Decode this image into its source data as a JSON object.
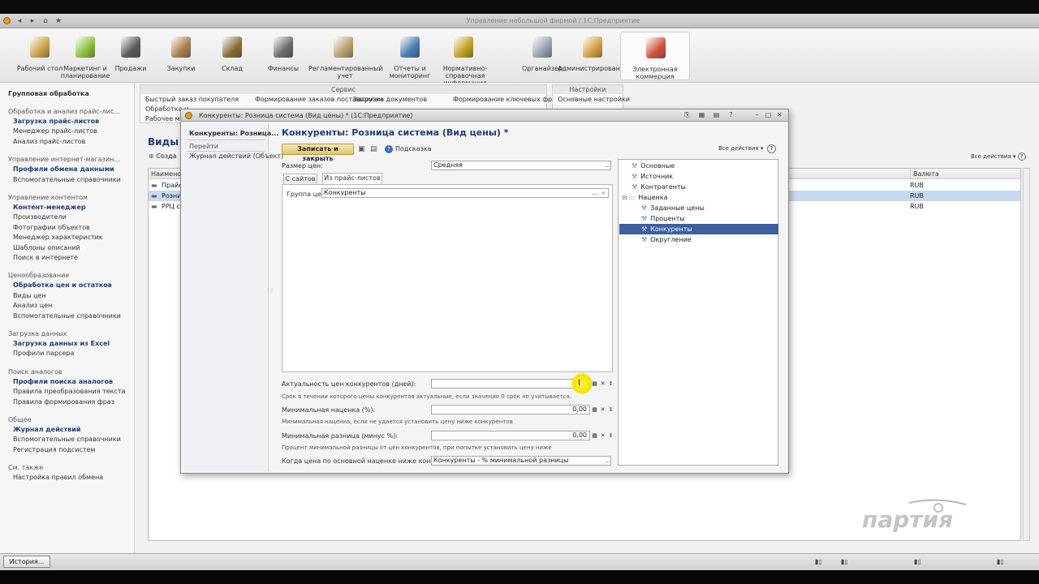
{
  "titlebar": {
    "title": "Управление небольшой фирмой / 1С:Предприятие"
  },
  "sections": [
    {
      "label": "Рабочий стол",
      "icon": "desk-icon",
      "color": "#c8a24a"
    },
    {
      "label": "Маркетинг и планирование",
      "icon": "marketing-icon",
      "color": "#8bbf3a"
    },
    {
      "label": "Продажи",
      "icon": "sales-icon",
      "color": "#5a5a5a"
    },
    {
      "label": "Закупки",
      "icon": "purchases-icon",
      "color": "#a88050"
    },
    {
      "label": "Склад",
      "icon": "warehouse-icon",
      "color": "#8a6a3a"
    },
    {
      "label": "Финансы",
      "icon": "finance-icon",
      "color": "#6a6a6a"
    },
    {
      "label": "Регламентированный учет",
      "icon": "accounting-icon",
      "color": "#b8a070"
    },
    {
      "label": "Отчеты и мониторинг",
      "icon": "reports-icon",
      "color": "#4a7ab0"
    },
    {
      "label": "Нормативно-справочная информация",
      "icon": "reference-icon",
      "color": "#c0a020"
    },
    {
      "label": "Органайзер",
      "icon": "organizer-icon",
      "color": "#9aa0a8"
    },
    {
      "label": "Администрирование",
      "icon": "admin-icon",
      "color": "#d0a040"
    },
    {
      "label": "Электронная коммерция",
      "icon": "ecommerce-icon",
      "color": "#d05040"
    }
  ],
  "service": {
    "caption": "Сервис",
    "items": [
      "Быстрый заказ покупателя",
      "Формирование заказов поставщикам",
      "Загрузка документов",
      "Формирование ключевых фраз",
      "Обработка н",
      "Рабочее мес"
    ],
    "settings_caption": "Настройки",
    "settings_item": "Основные настройки"
  },
  "left": {
    "top": "Групповая обработка",
    "groups": [
      {
        "title": "Обработка и анализ прайс-лис...",
        "items": [
          "Загрузка прайс-листов",
          "Менеджер прайс-листов",
          "Анализ прайс-листов"
        ],
        "bold": [
          0
        ]
      },
      {
        "title": "Управление интернет-магазин...",
        "items": [
          "Профили обмена данными",
          "Вспомогательные справочники"
        ],
        "bold": [
          0
        ]
      },
      {
        "title": "Управление контентом",
        "items": [
          "Контент-менеджер",
          "Производители",
          "Фотографии объектов",
          "Менеджер характеристик",
          "Шаблоны описаний",
          "Поиск в интернете"
        ],
        "bold": [
          0
        ]
      },
      {
        "title": "Ценообразование",
        "items": [
          "Обработка цен и остатков",
          "Виды цен",
          "Анализ цен",
          "Вспомогательные справочники"
        ],
        "bold": [
          0
        ]
      },
      {
        "title": "Загрузка данных",
        "items": [
          "Загрузка данных из Excel",
          "Профили парсера"
        ],
        "bold": [
          0
        ]
      },
      {
        "title": "Поиск аналогов",
        "items": [
          "Профили поиска аналогов",
          "Правила преобразования текста",
          "Правила формирования фраз"
        ],
        "bold": [
          0
        ]
      },
      {
        "title": "Общее",
        "items": [
          "Журнал действий",
          "Вспомогательные справочники",
          "Регистрация подсистем"
        ],
        "bold": [
          0
        ]
      },
      {
        "title": "См. также",
        "items": [
          "Настройка правил обмена"
        ],
        "bold": []
      }
    ]
  },
  "bglist": {
    "title": "Виды ц",
    "create": "Созда",
    "all_actions": "Все действия",
    "col_name": "Наименов",
    "col_currency": "Валюта",
    "rows": [
      {
        "name": "Прайс-",
        "currency": "RUB"
      },
      {
        "name": "Розниц",
        "currency": "RUB"
      },
      {
        "name": "РРЦ с",
        "currency": "RUB"
      }
    ]
  },
  "dialog": {
    "title": "Конкуренты: Розница система (Вид цены) * (1С:Предприятие)",
    "nav_title": "Конкуренты: Розница...",
    "nav_goto": "Перейти",
    "nav_item": "Журнал действий (Объект)",
    "heading": "Конкуренты: Розница система (Вид цены) *",
    "save_close": "Записать и закрыть",
    "hint": "Подсказка",
    "all_actions": "Все действия",
    "price_size_label": "Размер цен:",
    "price_size_value": "Средняя",
    "tabs": [
      "С сайтов",
      "Из прайс-листов"
    ],
    "group_label": "Группа цен:",
    "group_value": "Конкуренты",
    "relevance_label": "Актуальность цен конкурентов (дней):",
    "relevance_value": "",
    "relevance_note": "Срок в течении которого цены конкурентов актуальные, если значение 0 срок не учитывается.",
    "min_markup_label": "Минимальная наценка (%):",
    "min_markup_value": "0,00",
    "min_markup_note": "Минимальная наценка, если не удается установить цену ниже конкурентов",
    "min_diff_label": "Минимальная разница (минус %):",
    "min_diff_value": "0,00",
    "min_diff_note": "Процент минимальной разницы от цен конкурентов, при попытке установить цену ниже",
    "when_label": "Когда цена по основной наценке ниже конкурентов:",
    "when_value": "Конкуренты - % минимальной разницы",
    "tree": [
      {
        "label": "Основные",
        "level": 0
      },
      {
        "label": "Источник",
        "level": 0
      },
      {
        "label": "Контрагенты",
        "level": 0
      },
      {
        "label": "Наценка",
        "level": 0
      },
      {
        "label": "Заданные цены",
        "level": 1
      },
      {
        "label": "Проценты",
        "level": 1
      },
      {
        "label": "Конкуренты",
        "level": 1,
        "selected": true
      },
      {
        "label": "Округление",
        "level": 1
      }
    ]
  },
  "status": {
    "history": "История..."
  },
  "logo": {
    "text": "партия"
  },
  "colors": {
    "accent": "#1f3d7a",
    "selected": "#3d5f9e",
    "highlight": "#c8d8f0"
  }
}
